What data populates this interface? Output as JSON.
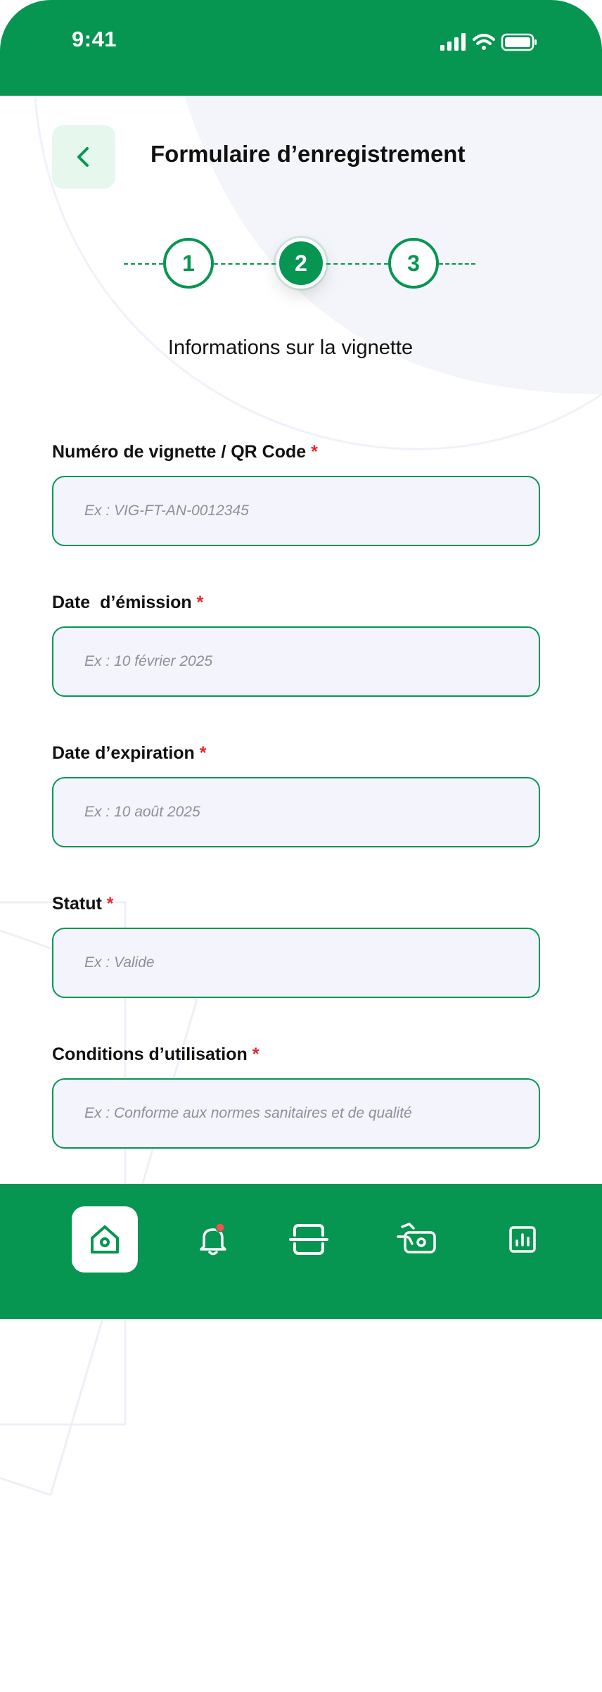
{
  "status_bar": {
    "time": "9:41"
  },
  "header": {
    "title": "Formulaire d’enregistrement"
  },
  "stepper": {
    "steps": [
      "1",
      "2",
      "3"
    ],
    "active_step": "2",
    "subtitle": "Informations sur la vignette"
  },
  "form": {
    "required_mark": "*",
    "fields": [
      {
        "label": "Numéro de vignette / QR Code",
        "placeholder": "Ex : VIG-FT-AN-0012345"
      },
      {
        "label": "Date  d’émission",
        "placeholder": "Ex : 10 février 2025"
      },
      {
        "label": "Date d’expiration",
        "placeholder": "Ex : 10 août 2025"
      },
      {
        "label": "Statut",
        "placeholder": "Ex : Valide"
      },
      {
        "label": "Conditions d’utilisation",
        "placeholder": "Ex : Conforme aux normes sanitaires et de qualité"
      }
    ]
  },
  "bottom_nav": {
    "items": [
      {
        "icon": "home-icon",
        "active": true
      },
      {
        "icon": "bell-icon",
        "active": false,
        "has_badge": true
      },
      {
        "icon": "scan-icon",
        "active": false
      },
      {
        "icon": "payment-icon",
        "active": false
      },
      {
        "icon": "stats-icon",
        "active": false
      }
    ]
  },
  "colors": {
    "brand_green": "#069651",
    "light_green": "#e6f8ee",
    "input_bg": "#f3f4fc",
    "required_red": "#e8262b",
    "badge_red": "#ff4d4d"
  }
}
